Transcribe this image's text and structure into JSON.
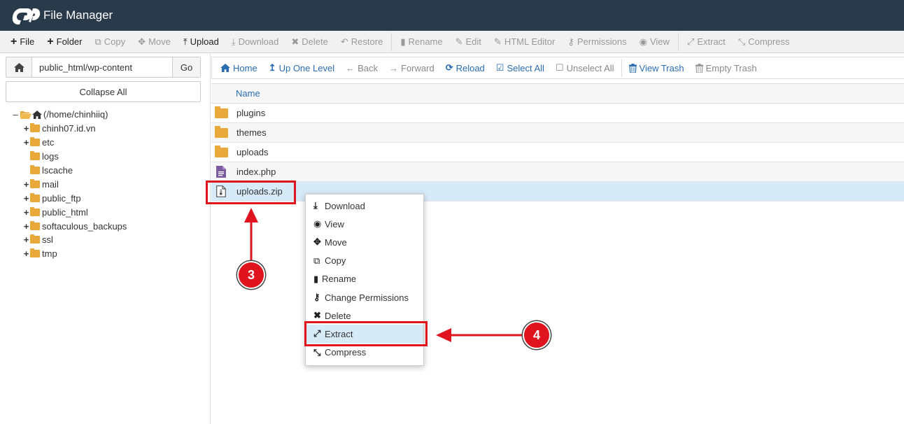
{
  "header": {
    "title": "File Manager",
    "logo_icon": "cpanel-logo-icon"
  },
  "toolbar": {
    "items": [
      {
        "label": "File",
        "icon": "+",
        "enabled": true
      },
      {
        "label": "Folder",
        "icon": "+",
        "enabled": true
      },
      {
        "label": "Copy",
        "icon": "⧉",
        "enabled": false
      },
      {
        "label": "Move",
        "icon": "✥",
        "enabled": false
      },
      {
        "label": "Upload",
        "icon": "⤒",
        "enabled": true
      },
      {
        "label": "Download",
        "icon": "⤓",
        "enabled": false
      },
      {
        "label": "Delete",
        "icon": "✖",
        "enabled": false
      },
      {
        "label": "Restore",
        "icon": "↶",
        "enabled": false
      },
      {
        "label": "Rename",
        "icon": "▮",
        "enabled": false
      },
      {
        "label": "Edit",
        "icon": "✎",
        "enabled": false
      },
      {
        "label": "HTML Editor",
        "icon": "✎",
        "enabled": false
      },
      {
        "label": "Permissions",
        "icon": "⚷",
        "enabled": false
      },
      {
        "label": "View",
        "icon": "◉",
        "enabled": false
      },
      {
        "label": "Extract",
        "icon": "⤢",
        "enabled": false
      },
      {
        "label": "Compress",
        "icon": "⤡",
        "enabled": false
      }
    ]
  },
  "sidebar": {
    "path_value": "public_html/wp-content",
    "go_label": "Go",
    "collapse_label": "Collapse All",
    "root_label": "(/home/chinhiiq)",
    "tree": [
      {
        "label": "chinh07.id.vn",
        "expandable": true
      },
      {
        "label": "etc",
        "expandable": true
      },
      {
        "label": "logs",
        "expandable": false
      },
      {
        "label": "lscache",
        "expandable": false
      },
      {
        "label": "mail",
        "expandable": true
      },
      {
        "label": "public_ftp",
        "expandable": true
      },
      {
        "label": "public_html",
        "expandable": true
      },
      {
        "label": "softaculous_backups",
        "expandable": true
      },
      {
        "label": "ssl",
        "expandable": true
      },
      {
        "label": "tmp",
        "expandable": true
      }
    ]
  },
  "subtoolbar": {
    "items": [
      {
        "label": "Home",
        "icon": "⌂",
        "enabled": true
      },
      {
        "label": "Up One Level",
        "icon": "↥",
        "enabled": true
      },
      {
        "label": "Back",
        "icon": "←",
        "enabled": false
      },
      {
        "label": "Forward",
        "icon": "→",
        "enabled": false
      },
      {
        "label": "Reload",
        "icon": "⟳",
        "enabled": true
      },
      {
        "label": "Select All",
        "icon": "☑",
        "enabled": true
      },
      {
        "label": "Unselect All",
        "icon": "☐",
        "enabled": false
      },
      {
        "label": "View Trash",
        "icon": "🗑",
        "enabled": true
      },
      {
        "label": "Empty Trash",
        "icon": "🗑",
        "enabled": false
      }
    ]
  },
  "files": {
    "column_name": "Name",
    "rows": [
      {
        "name": "plugins",
        "type": "folder"
      },
      {
        "name": "themes",
        "type": "folder"
      },
      {
        "name": "uploads",
        "type": "folder"
      },
      {
        "name": "index.php",
        "type": "php"
      },
      {
        "name": "uploads.zip",
        "type": "zip"
      }
    ]
  },
  "context_menu": {
    "items": [
      {
        "label": "Download",
        "icon": "⤓"
      },
      {
        "label": "View",
        "icon": "◉"
      },
      {
        "label": "Move",
        "icon": "✥"
      },
      {
        "label": "Copy",
        "icon": "⧉"
      },
      {
        "label": "Rename",
        "icon": "▮"
      },
      {
        "label": "Change Permissions",
        "icon": "⚷"
      },
      {
        "label": "Delete",
        "icon": "✖"
      },
      {
        "label": "Extract",
        "icon": "⤢"
      },
      {
        "label": "Compress",
        "icon": "⤡"
      }
    ]
  },
  "annotations": {
    "step_3": "3",
    "step_4": "4",
    "color": "#e0141e"
  }
}
